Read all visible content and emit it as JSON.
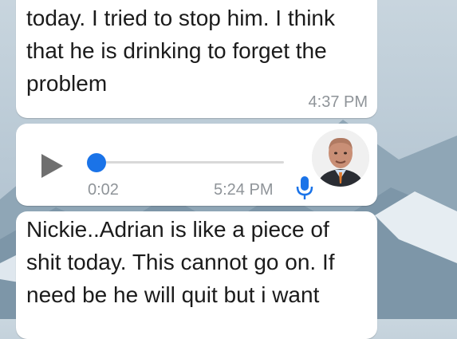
{
  "messages": [
    {
      "text": "today.  I tried to stop him. I think\nthat he is drinking to forget the\nproblem",
      "time": "4:37 PM"
    },
    {
      "type": "voice",
      "duration": "0:02",
      "time": "5:24 PM",
      "playback_progress": 0.0
    },
    {
      "text": "Nickie..Adrian is like a piece of\nshit today. This cannot go on. If\nneed be he will quit but i want"
    }
  ],
  "colors": {
    "bubble": "#ffffff",
    "accent": "#1a73e8",
    "timestamp": "#8f9499"
  },
  "icons": [
    "play-icon",
    "mic-icon",
    "avatar"
  ]
}
